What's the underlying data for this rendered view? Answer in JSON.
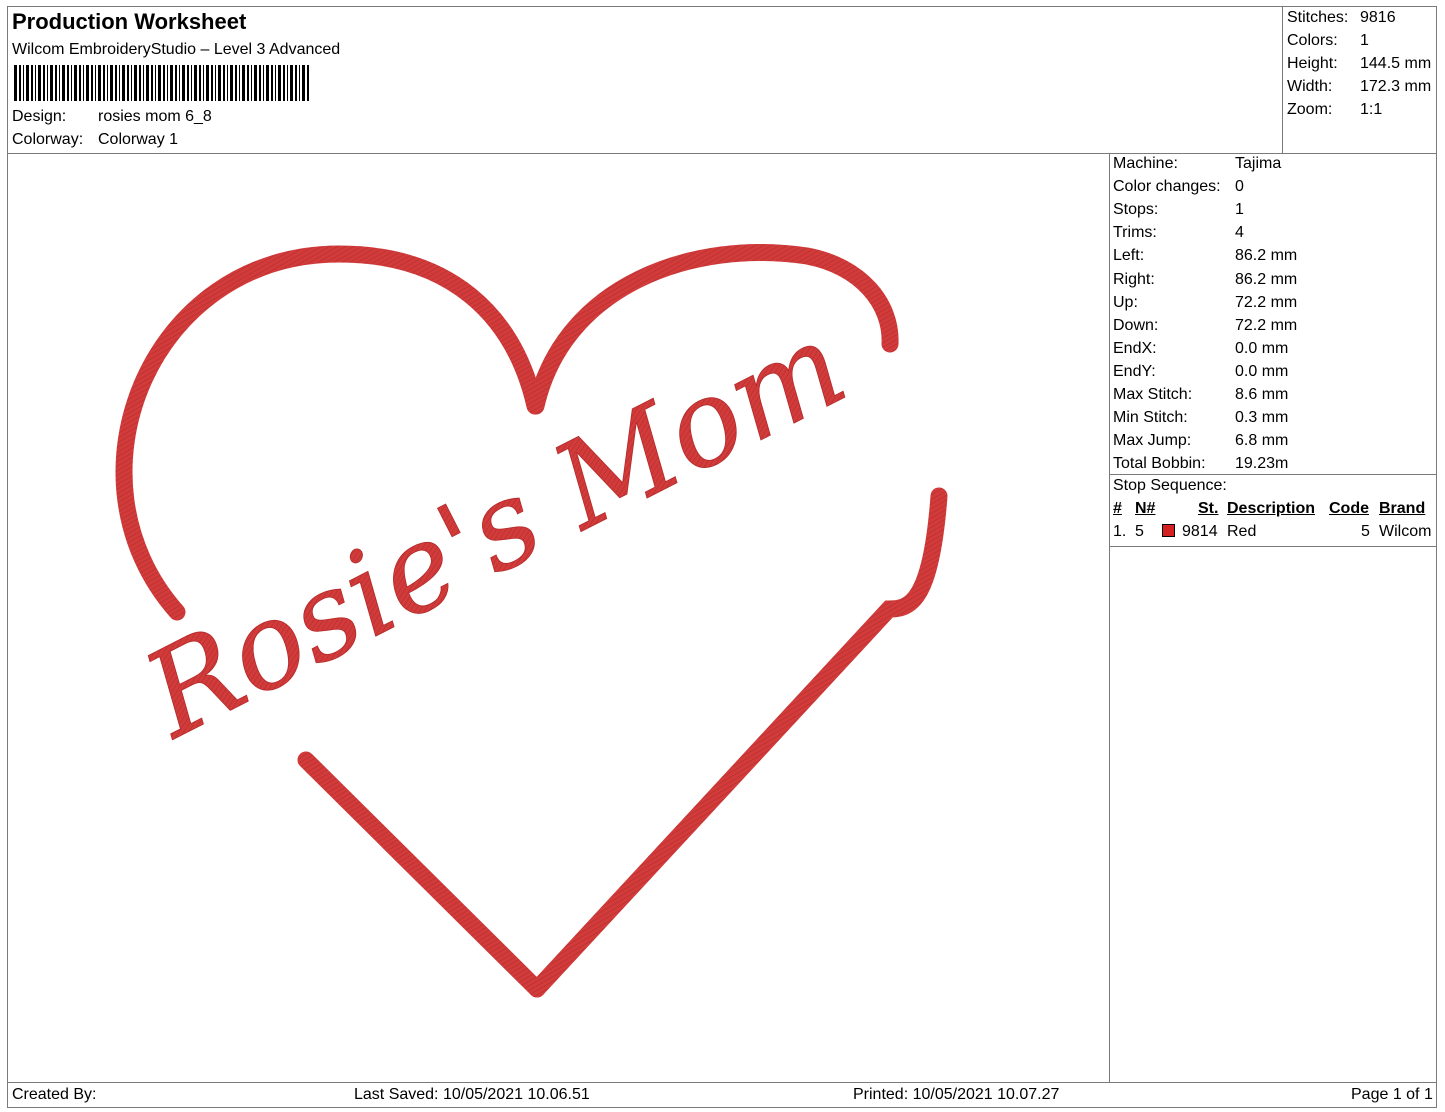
{
  "header": {
    "title": "Production Worksheet",
    "software": "Wilcom EmbroideryStudio – Level 3 Advanced",
    "design_label": "Design:",
    "design_value": "rosies mom 6_8",
    "colorway_label": "Colorway:",
    "colorway_value": "Colorway 1"
  },
  "summary": {
    "stitches_label": "Stitches:",
    "stitches": "9816",
    "colors_label": "Colors:",
    "colors": "1",
    "height_label": "Height:",
    "height": "144.5 mm",
    "width_label": "Width:",
    "width": "172.3 mm",
    "zoom_label": "Zoom:",
    "zoom": "1:1"
  },
  "machine_info": [
    {
      "label": "Machine:",
      "value": "Tajima"
    },
    {
      "label": "Color changes:",
      "value": "0"
    },
    {
      "label": "Stops:",
      "value": "1"
    },
    {
      "label": "Trims:",
      "value": "4"
    },
    {
      "label": "Left:",
      "value": "86.2 mm"
    },
    {
      "label": "Right:",
      "value": "86.2 mm"
    },
    {
      "label": "Up:",
      "value": "72.2 mm"
    },
    {
      "label": "Down:",
      "value": "72.2 mm"
    },
    {
      "label": "EndX:",
      "value": "0.0 mm"
    },
    {
      "label": "EndY:",
      "value": "0.0 mm"
    },
    {
      "label": "Max Stitch:",
      "value": "8.6 mm"
    },
    {
      "label": "Min Stitch:",
      "value": "0.3 mm"
    },
    {
      "label": "Max Jump:",
      "value": "6.8 mm"
    },
    {
      "label": "Total Bobbin:",
      "value": "19.23m"
    }
  ],
  "stop_sequence": {
    "title": "Stop Sequence:",
    "headers": {
      "index": "#",
      "needle": "N#",
      "stitches": "St.",
      "description": "Description",
      "code": "Code",
      "brand": "Brand"
    },
    "rows": [
      {
        "index": "1.",
        "needle": "5",
        "stitches": "9814",
        "description": "Red",
        "code": "5",
        "brand": "Wilcom",
        "color": "#d42020"
      }
    ]
  },
  "design": {
    "text": "Rosie's Mom",
    "thread_color": "#d33a3a"
  },
  "footer": {
    "created_by": "Created By:",
    "last_saved": "Last Saved: 10/05/2021 10.06.51",
    "printed": "Printed: 10/05/2021 10.07.27",
    "page": "Page 1 of 1"
  }
}
